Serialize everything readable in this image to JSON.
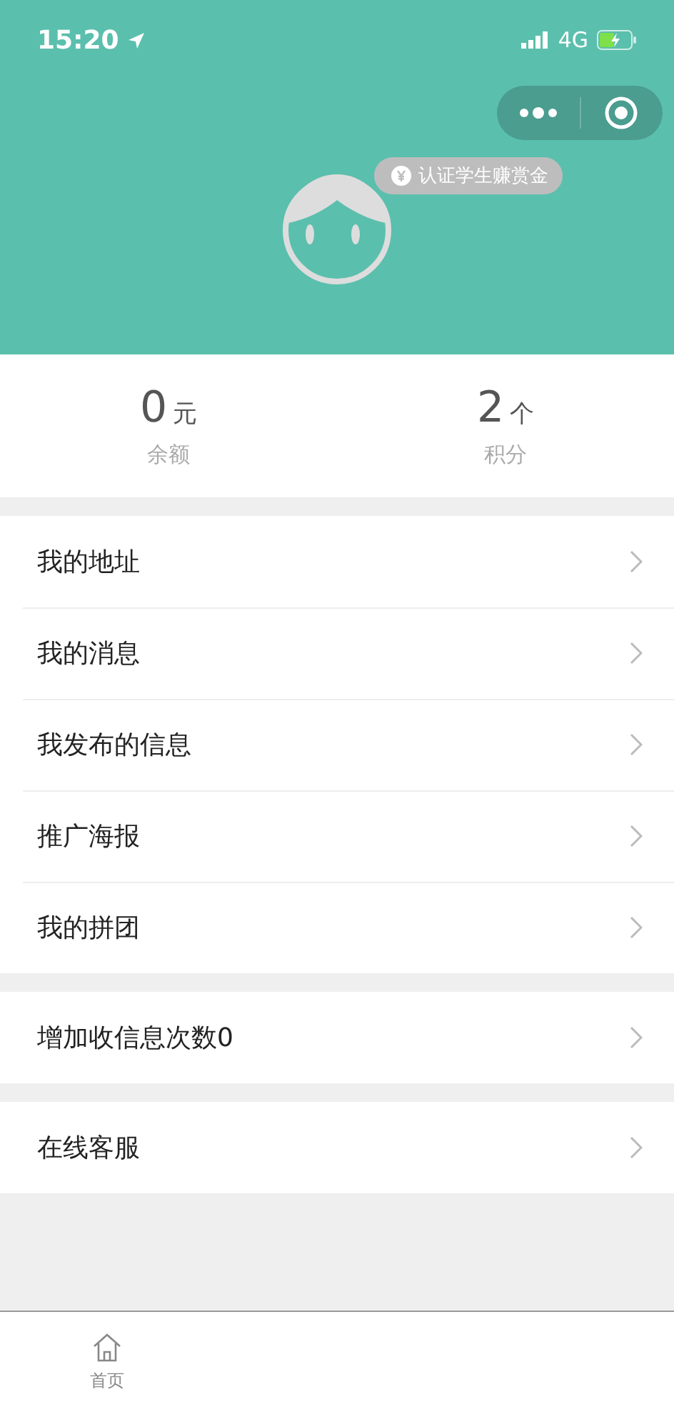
{
  "status_bar": {
    "time": "15:20",
    "network": "4G"
  },
  "header": {
    "badge": "认证学生赚赏金"
  },
  "stats": [
    {
      "value": "0",
      "unit": "元",
      "label": "余额"
    },
    {
      "value": "2",
      "unit": "个",
      "label": "积分"
    }
  ],
  "menu_groups": [
    [
      {
        "label": "我的地址"
      },
      {
        "label": "我的消息"
      },
      {
        "label": "我发布的信息"
      },
      {
        "label": "推广海报"
      },
      {
        "label": "我的拼团"
      }
    ],
    [
      {
        "label": "增加收信息次数0"
      }
    ],
    [
      {
        "label": "在线客服"
      }
    ]
  ],
  "tab_bar": [
    {
      "label": "首页"
    }
  ]
}
